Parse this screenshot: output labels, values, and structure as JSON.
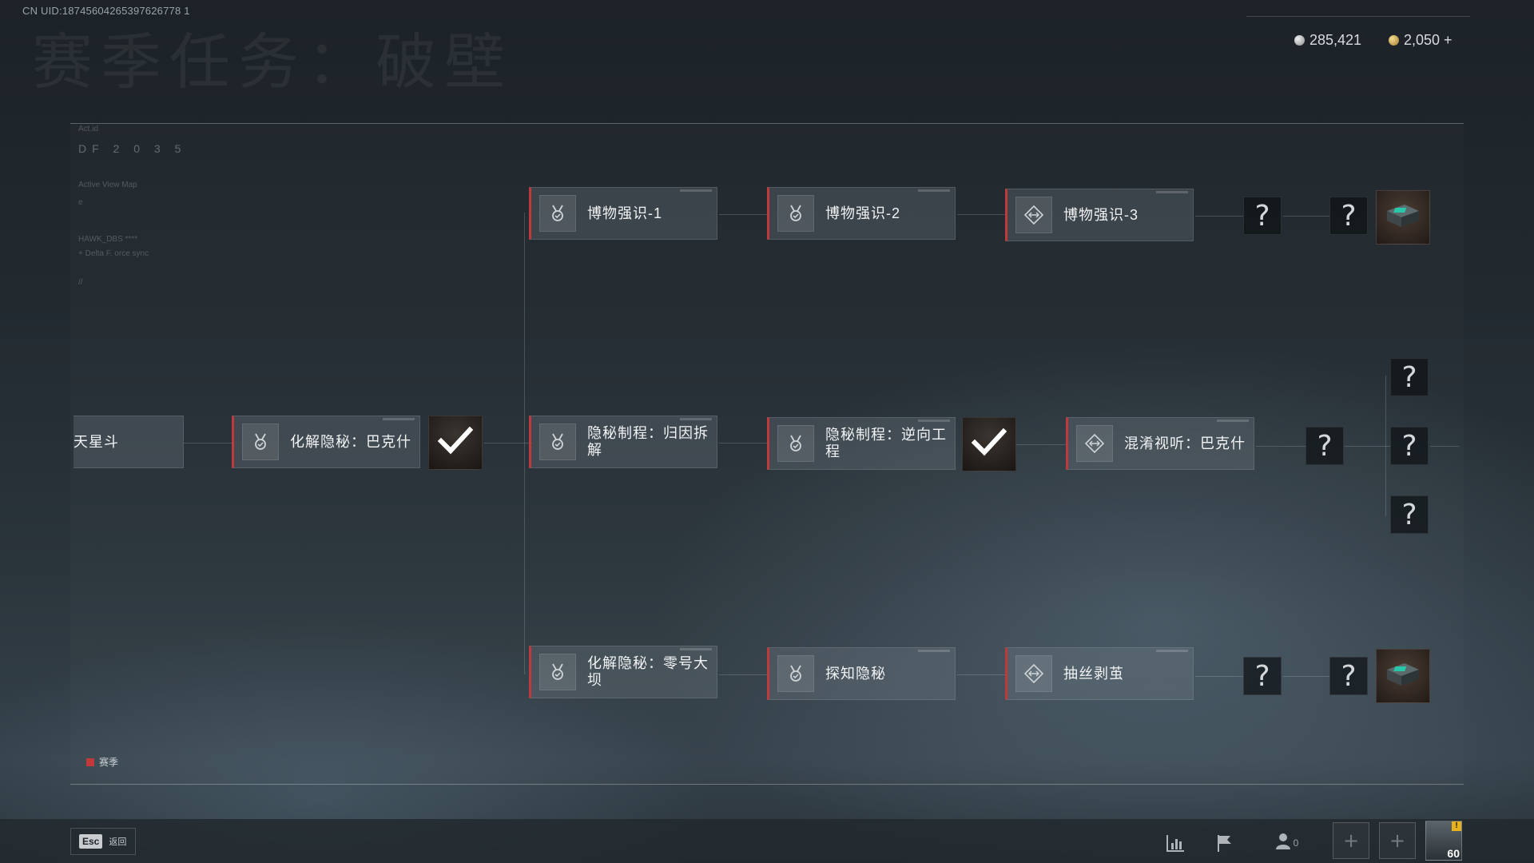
{
  "header": {
    "uid": "CN UID:18745604265397626778 1",
    "ghost_title": "赛季任务：破壁",
    "currency": [
      {
        "icon": "silver-coin-icon",
        "value": "285,421"
      },
      {
        "icon": "gold-coin-icon",
        "value": "2,050 +"
      }
    ]
  },
  "hud": {
    "line1": "Act.id",
    "df": "DF 2 0 3 5",
    "line3": "Active View Map",
    "line4": "e",
    "line5": "HAWK_DBS ****",
    "line6": "+ Delta F. orce sync",
    "line7": "//"
  },
  "tasks": {
    "partial": "天星斗",
    "c1": "化解隐秘：巴克什",
    "top1": "博物强识-1",
    "top2": "博物强识-2",
    "top3": "博物强识-3",
    "mid1": "隐秘制程：归因拆解",
    "mid2": "隐秘制程：逆向工程",
    "mid3": "混淆视听：巴克什",
    "bot1": "化解隐秘：零号大坝",
    "bot2": "探知隐秘",
    "bot3": "抽丝剥茧"
  },
  "unknown_symbol": "?",
  "legend": {
    "label": "赛季",
    "color": "#c0393b"
  },
  "footer": {
    "esc_key": "Esc",
    "esc_label": "返回",
    "friends_count": "0",
    "slot_symbol": "+",
    "player_level": "60",
    "alert": "!"
  }
}
